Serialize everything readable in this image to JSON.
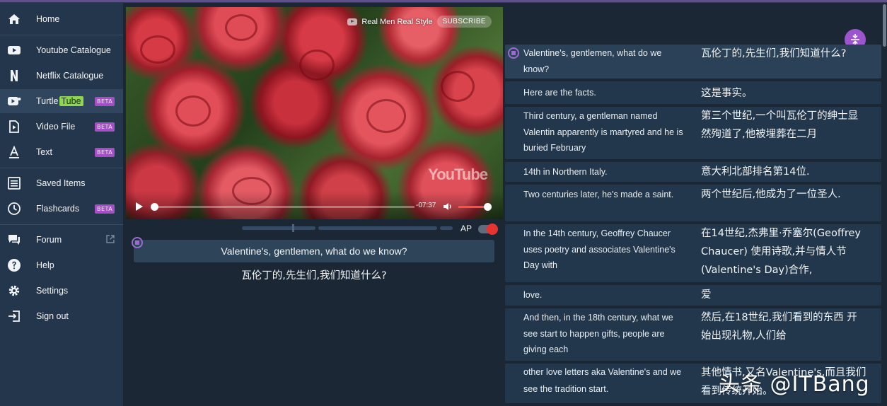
{
  "sidebar": {
    "items": [
      {
        "label": "Home",
        "icon": "home-icon"
      },
      {
        "label": "Youtube Catalogue",
        "icon": "youtube-icon"
      },
      {
        "label": "Netflix Catalogue",
        "icon": "netflix-icon"
      },
      {
        "label": "Turtle",
        "label_badge": "Tube",
        "icon": "turtletube-icon",
        "beta": "BETA"
      },
      {
        "label": "Video File",
        "icon": "video-file-icon",
        "beta": "BETA"
      },
      {
        "label": "Text",
        "icon": "text-icon",
        "beta": "BETA"
      },
      {
        "label": "Saved Items",
        "icon": "list-icon"
      },
      {
        "label": "Flashcards",
        "icon": "clock-icon",
        "beta": "BETA"
      },
      {
        "label": "Forum",
        "icon": "forum-icon"
      },
      {
        "label": "Help",
        "icon": "help-icon"
      },
      {
        "label": "Settings",
        "icon": "gear-icon"
      },
      {
        "label": "Sign out",
        "icon": "sign-out-icon"
      }
    ]
  },
  "video": {
    "channel_name": "Real Men Real Style",
    "subscribe_label": "SUBSCRIBE",
    "watermark": "YouTube",
    "time": "-07:37",
    "progress": 0.0,
    "volume": 0.9
  },
  "player": {
    "ap_label": "AP",
    "ap_on": true,
    "current_en": "Valentine's, gentlemen, what do we know?",
    "current_zh": "瓦伦丁的,先生们,我们知道什么?"
  },
  "transcript": [
    {
      "en": "Valentine's, gentlemen, what do we know?",
      "zh": "瓦伦丁的,先生们,我们知道什么?",
      "active": true
    },
    {
      "en": "Here are the facts.",
      "zh": "这是事实。"
    },
    {
      "en": "Third century, a gentleman named Valentin apparently is martyred and he is buried February",
      "zh": "第三个世纪,一个叫瓦伦丁的绅士显然殉道了,他被埋葬在二月"
    },
    {
      "en": "14th in Northern Italy.",
      "zh": "意大利北部排名第14位."
    },
    {
      "en": "Two centuries later, he's made a saint.",
      "zh": "两个世纪后,他成为了一位圣人."
    },
    {
      "en": "In the 14th century, Geoffrey Chaucer uses poetry and associates Valentine's Day with",
      "zh": "在14世纪,杰弗里·乔塞尔(Geoffrey Chaucer) 使用诗歌,并与情人节(Valentine's Day)合作,"
    },
    {
      "en": "love.",
      "zh": "爱"
    },
    {
      "en": "And then, in the 18th century, what we see start to happen gifts, people are giving each",
      "zh": "然后,在18世纪,我们看到的东西 开始出现礼物,人们给"
    },
    {
      "en": "other love letters aka Valentine's and we see the tradition start.",
      "zh": "其他情书,又名Valentine's,而且我们看到传统开始。"
    }
  ],
  "watermark": "头条 @ITBang",
  "colors": {
    "accent": "#9c55cf",
    "beta": "#a44fc4",
    "tube": "#8dd650",
    "ap_knob": "#e8342e"
  }
}
